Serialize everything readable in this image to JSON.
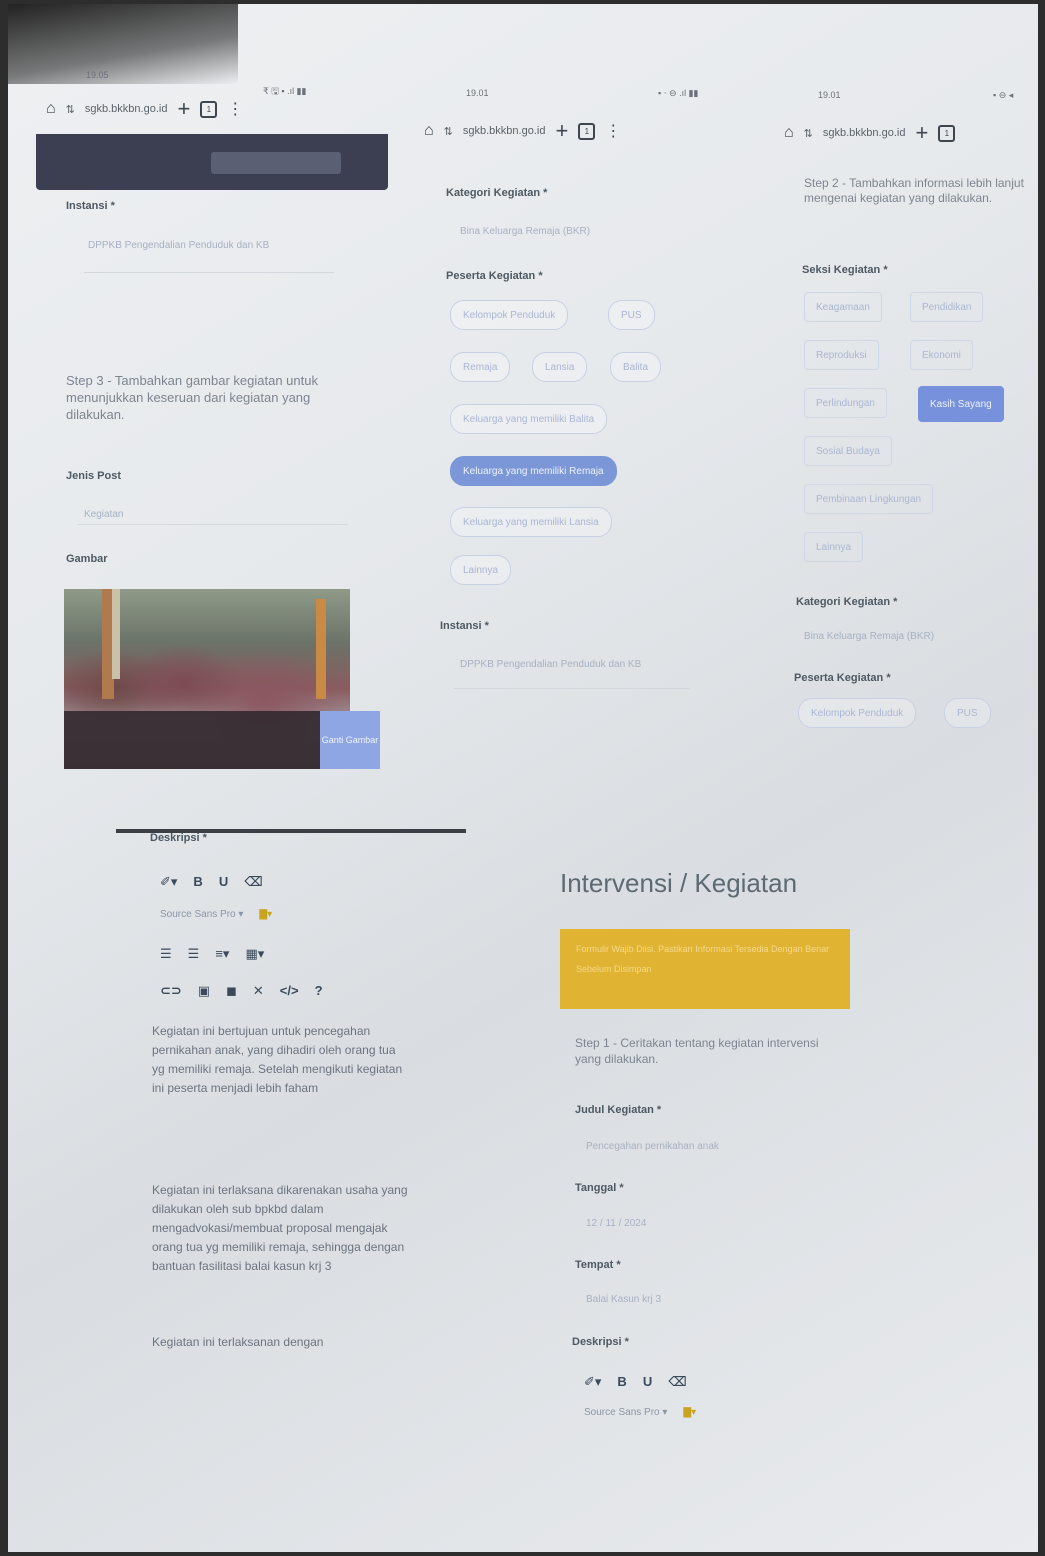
{
  "left_shot": {
    "time": "19.05",
    "status_icons": "₹ 🖫 ▪ .ıl ▮▮",
    "url": "sgkb.bkkbn.go.id",
    "instansi_label": "Instansi *",
    "instansi_value": "DPPKB Pengendalian Penduduk dan KB",
    "step3": "Step 3 - Tambahkan gambar kegiatan untuk menunjukkan keseruan dari kegiatan yang dilakukan.",
    "jenis_post_label": "Jenis Post",
    "jenis_post_value": "Kegiatan",
    "gambar_label": "Gambar",
    "photo_button": "Ganti Gambar",
    "deskripsi_label": "Deskripsi *",
    "font_select": "Source Sans Pro ▾",
    "paragraphs": [
      "Kegiatan ini bertujuan untuk pencegahan pernikahan anak, yang dihadiri oleh orang tua yg memiliki remaja. Setelah mengikuti kegiatan ini peserta menjadi lebih faham",
      "Kegiatan ini terlaksana dikarenakan usaha yang dilakukan oleh sub bpkbd dalam mengadvokasi/membuat proposal mengajak orang tua yg memiliki remaja, sehingga dengan bantuan fasilitasi balai kasun krj 3",
      "Kegiatan ini terlaksanan dengan"
    ]
  },
  "middle_shot": {
    "time": "19.01",
    "status_icons": "▪ ⋅ ⊖ .ıl ▮▮",
    "url": "sgkb.bkkbn.go.id",
    "kategori_label": "Kategori Kegiatan *",
    "kategori_value": "Bina Keluarga Remaja (BKR)",
    "peserta_label": "Peserta Kegiatan *",
    "chips": [
      {
        "label": "Kelompok Penduduk",
        "selected": false
      },
      {
        "label": "PUS",
        "selected": false
      },
      {
        "label": "Remaja",
        "selected": false
      },
      {
        "label": "Lansia",
        "selected": false
      },
      {
        "label": "Balita",
        "selected": false
      },
      {
        "label": "Keluarga yang memiliki Balita",
        "selected": false
      },
      {
        "label": "Keluarga yang memiliki Remaja",
        "selected": true
      },
      {
        "label": "Keluarga yang memiliki Lansia",
        "selected": false
      },
      {
        "label": "Lainnya",
        "selected": false
      }
    ],
    "instansi_label": "Instansi *",
    "instansi_value": "DPPKB Pengendalian Penduduk dan KB"
  },
  "right_shot": {
    "time": "19.01",
    "status_icons": "▪ ⊖ ◂",
    "url": "sgkb.bkkbn.go.id",
    "step2": "Step 2 - Tambahkan informasi lebih lanjut mengenai kegiatan yang dilakukan.",
    "seksi_label": "Seksi Kegiatan *",
    "chips": [
      {
        "label": "Keagamaan",
        "selected": false
      },
      {
        "label": "Pendidikan",
        "selected": false
      },
      {
        "label": "Reproduksi",
        "selected": false
      },
      {
        "label": "Ekonomi",
        "selected": false
      },
      {
        "label": "Perlindungan",
        "selected": false
      },
      {
        "label": "Kasih Sayang",
        "selected": true
      },
      {
        "label": "Sosial Budaya",
        "selected": false
      },
      {
        "label": "Pembinaan Lingkungan",
        "selected": false
      },
      {
        "label": "Lainnya",
        "selected": false
      }
    ],
    "kategori_label": "Kategori Kegiatan *",
    "kategori_value": "Bina Keluarga Remaja (BKR)",
    "peserta_label": "Peserta Kegiatan *",
    "peserta_chips": [
      "Kelompok Penduduk",
      "PUS"
    ]
  },
  "bottom_right_shot": {
    "title": "Intervensi / Kegiatan",
    "warning": "Formulir Wajib Diisi. Pastikan Informasi Tersedia Dengan Benar Sebelum Disimpan",
    "step1": "Step 1 - Ceritakan tentang kegiatan intervensi yang dilakukan.",
    "judul_label": "Judul Kegiatan *",
    "judul_value": "Pencegahan pernikahan anak",
    "tanggal_label": "Tanggal *",
    "tanggal_value": "12 / 11 / 2024",
    "tempat_label": "Tempat *",
    "tempat_value": "Balai Kasun krj 3",
    "deskripsi_label": "Deskripsi *",
    "font_select": "Source Sans Pro ▾"
  }
}
